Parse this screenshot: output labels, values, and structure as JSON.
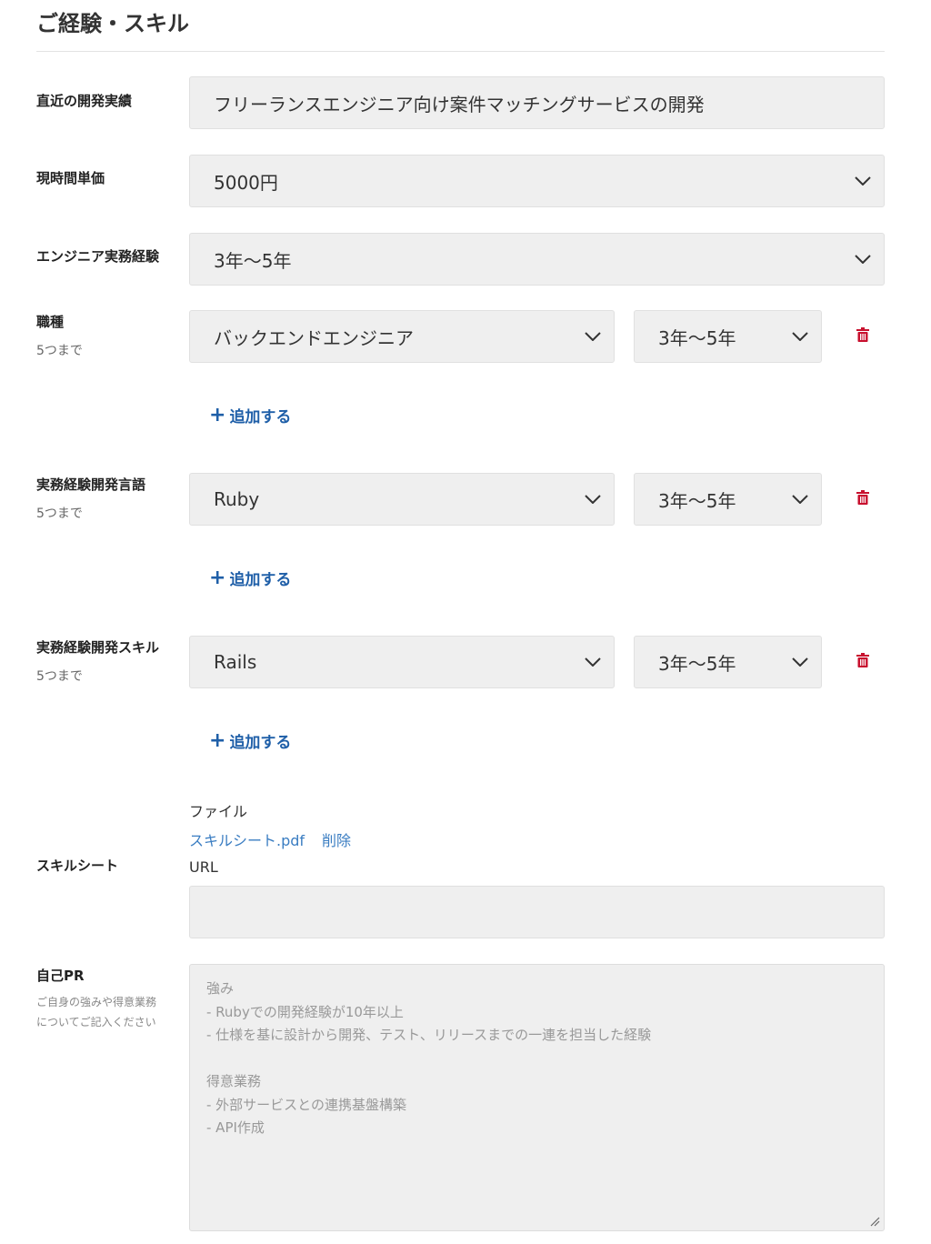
{
  "section": {
    "title": "ご経験・スキル"
  },
  "recent_project": {
    "label": "直近の開発実績",
    "value": "フリーランスエンジニア向け案件マッチングサービスの開発"
  },
  "hourly_rate": {
    "label": "現時間単価",
    "selected": "5000円"
  },
  "engineer_experience": {
    "label": "エンジニア実務経験",
    "selected": "3年〜5年"
  },
  "job_types": {
    "label": "職種",
    "limit": "5つまで",
    "items": [
      {
        "value": "バックエンドエンジニア",
        "years": "3年〜5年"
      }
    ],
    "add_label": "追加する"
  },
  "languages": {
    "label": "実務経験開発言語",
    "limit": "5つまで",
    "items": [
      {
        "value": "Ruby",
        "years": "3年〜5年"
      }
    ],
    "add_label": "追加する"
  },
  "skills": {
    "label": "実務経験開発スキル",
    "limit": "5つまで",
    "items": [
      {
        "value": "Rails",
        "years": "3年〜5年"
      }
    ],
    "add_label": "追加する"
  },
  "skill_sheet": {
    "label": "スキルシート",
    "file_label": "ファイル",
    "file_name": "スキルシート.pdf",
    "delete_label": "削除",
    "url_label": "URL",
    "url_value": ""
  },
  "self_pr": {
    "label": "自己PR",
    "hint_lines": [
      "ご自身の強みや得意業務",
      "についてご記入ください"
    ],
    "placeholder_lines": [
      "強み",
      "- Rubyでの開発経験が10年以上",
      "- 仕様を基に設計から開発、テスト、リリースまでの一連を担当した経験",
      "",
      "得意業務",
      "- 外部サービスとの連携基盤構築",
      "- API作成"
    ]
  },
  "colors": {
    "field_bg": "#efefef",
    "link": "#3a7dc2",
    "add": "#1f5fa8",
    "trash": "#c8102e"
  },
  "icons": {
    "dropdown": "chevron-down-icon",
    "delete": "trash-icon",
    "add": "plus-icon",
    "resize": "resize-handle-icon"
  }
}
